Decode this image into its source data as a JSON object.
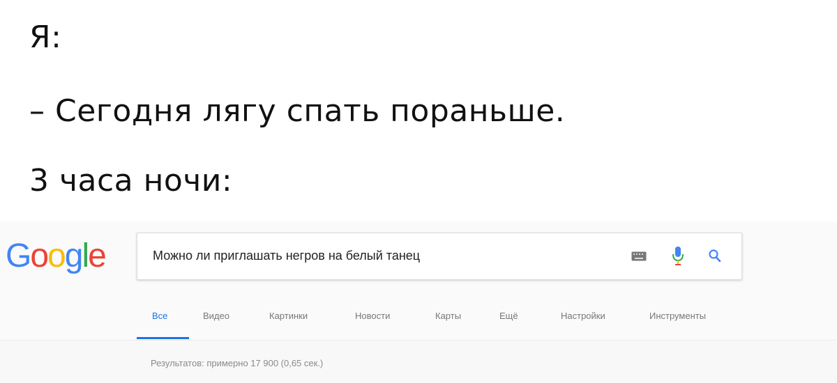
{
  "meme": {
    "line1": "Я:",
    "line2": "– Сегодня лягу спать пораньше.",
    "line3": "3 часа ночи:"
  },
  "google": {
    "logo_letters": [
      {
        "char": "G",
        "color": "#4285F4"
      },
      {
        "char": "o",
        "color": "#EA4335"
      },
      {
        "char": "o",
        "color": "#FBBC05"
      },
      {
        "char": "g",
        "color": "#4285F4"
      },
      {
        "char": "l",
        "color": "#34A853"
      },
      {
        "char": "e",
        "color": "#EA4335"
      }
    ],
    "query": "Можно ли приглашать негров на белый танец",
    "icons": [
      "keyboard-icon",
      "mic-icon",
      "search-icon"
    ],
    "tabs": [
      {
        "label": "Все",
        "active": true
      },
      {
        "label": "Видео",
        "active": false
      },
      {
        "label": "Картинки",
        "active": false
      },
      {
        "label": "Новости",
        "active": false
      },
      {
        "label": "Карты",
        "active": false
      },
      {
        "label": "Ещё",
        "active": false
      },
      {
        "label": "Настройки",
        "active": false
      },
      {
        "label": "Инструменты",
        "active": false
      }
    ],
    "results_stats": "Результатов: примерно 17 900 (0,65 сек.)",
    "accent_color": "#1a73e8"
  }
}
